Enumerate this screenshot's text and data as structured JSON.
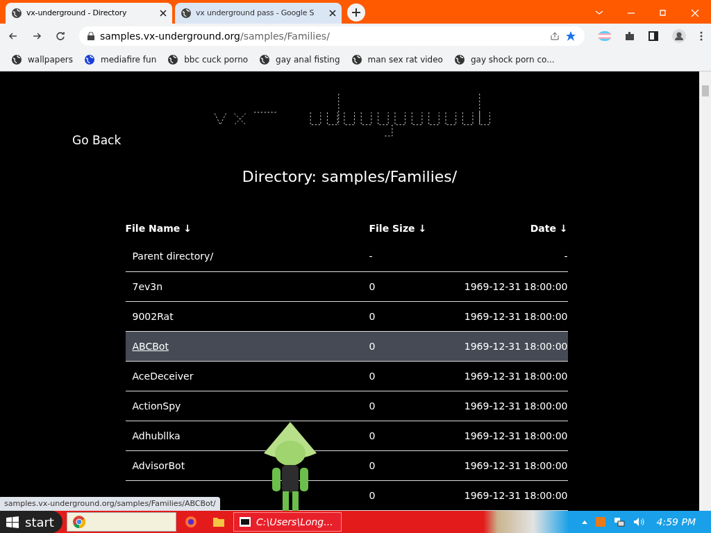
{
  "browser": {
    "tabs": [
      {
        "title": "vx-underground - Directory",
        "selected": true
      },
      {
        "title": "vx underground pass - Google S",
        "selected": false
      }
    ],
    "address": {
      "host": "samples.vx-underground.org",
      "path": "/samples/Families/"
    },
    "bookmarks": [
      "wallpapers",
      "mediafire fun",
      "bbc cuck porno",
      "gay anal fisting",
      "man sex rat video",
      "gay shock porn co..."
    ]
  },
  "page": {
    "back_link": "Go Back",
    "heading": "Directory: samples/Families/",
    "columns": [
      {
        "label": "File Name",
        "arrow": "↓"
      },
      {
        "label": "File Size",
        "arrow": "↓"
      },
      {
        "label": "Date",
        "arrow": "↓"
      }
    ],
    "rows": [
      {
        "name": "Parent directory/",
        "size": "-",
        "date": "-",
        "selected": false
      },
      {
        "name": "7ev3n",
        "size": "0",
        "date": "1969-12-31 18:00:00",
        "selected": false
      },
      {
        "name": "9002Rat",
        "size": "0",
        "date": "1969-12-31 18:00:00",
        "selected": false
      },
      {
        "name": "ABCBot",
        "size": "0",
        "date": "1969-12-31 18:00:00",
        "selected": true
      },
      {
        "name": "AceDeceiver",
        "size": "0",
        "date": "1969-12-31 18:00:00",
        "selected": false
      },
      {
        "name": "ActionSpy",
        "size": "0",
        "date": "1969-12-31 18:00:00",
        "selected": false
      },
      {
        "name": "Adhubllka",
        "size": "0",
        "date": "1969-12-31 18:00:00",
        "selected": false
      },
      {
        "name": "AdvisorBot",
        "size": "0",
        "date": "1969-12-31 18:00:00",
        "selected": false
      },
      {
        "size": "0",
        "date": "1969-12-31 18:00:00",
        "selected": false
      }
    ]
  },
  "status_url": "samples.vx-underground.org/samples/Families/ABCBot/",
  "taskbar": {
    "start": "start",
    "task": "C:\\Users\\Long...",
    "clock": "4:59 PM"
  }
}
